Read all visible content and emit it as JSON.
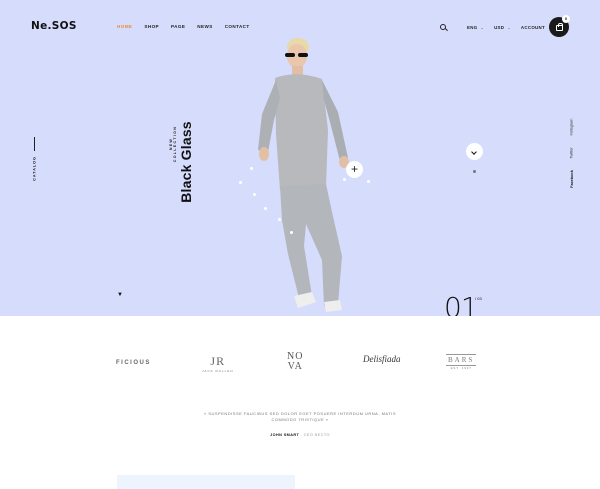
{
  "header": {
    "logo": "Ne.SOS",
    "nav": [
      "HOME",
      "SHOP",
      "PAGE",
      "NEWS",
      "CONTACT"
    ],
    "active_nav": "HOME",
    "language": "ENG",
    "currency": "USD",
    "account": "ACCOUNT",
    "cart_count": "0"
  },
  "hero": {
    "side_label": "CATALOG",
    "eyebrow": "NEW COLLECTION",
    "title": "Black Glass",
    "slide_number": "01",
    "slide_total": "/ 03",
    "social": [
      "Instagram",
      "Twitter",
      "Facebook"
    ],
    "active_social": "Facebook"
  },
  "brands": {
    "b1": "FICIOUS",
    "b2_big": "JR",
    "b2_small": "JACK ROLLEN",
    "b3_top": "NO",
    "b3_bottom": "VA",
    "b4": "Delisfiada",
    "b5_big": "BARS",
    "b5_small": "EST. 1997"
  },
  "testimonial": {
    "quote": "« SUSPENDISSE FAUCIBUS SED DOLOR EGET POSUERE INTERDUM URNA. MATIS COMMODO TRISTIQUE »",
    "author": "JOHN SMART",
    "role": "- CEO NECTO"
  },
  "colors": {
    "hero_bg": "#d6dcfb",
    "accent": "#ef8a3c",
    "dark": "#1a1a1a"
  }
}
